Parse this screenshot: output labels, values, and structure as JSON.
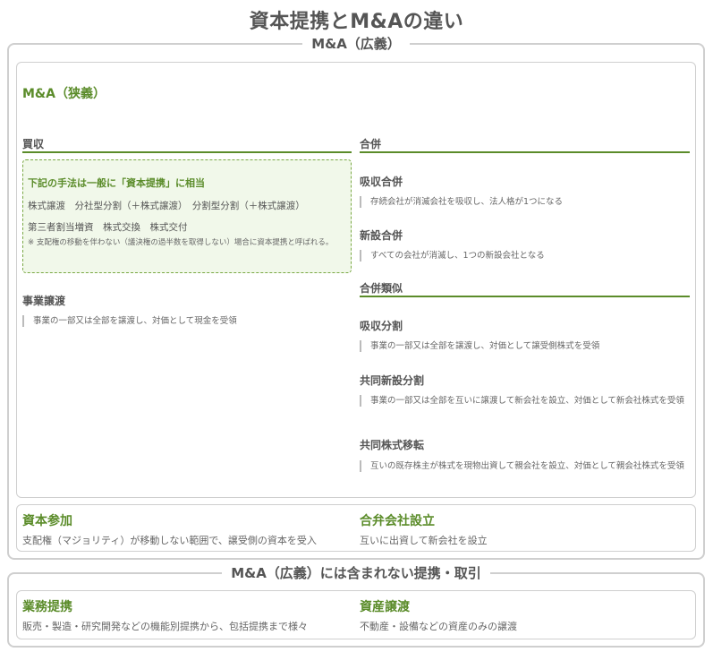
{
  "title": "資本提携とM&Aの違い",
  "ma_broad": {
    "label": "M&A（広義）",
    "ma_narrow": {
      "label": "M&A（狭義）",
      "acquisition": {
        "heading": "買収",
        "box": {
          "heading": "下記の手法は一般に「資本提携」に相当",
          "line1": "株式譲渡　分社型分割（＋株式譲渡）　分割型分割（＋株式譲渡）",
          "line2": "第三者割当増資　株式交換　株式交付",
          "note": "※ 支配権の移動を伴わない（議決権の過半数を取得しない）場合に資本提携と呼ばれる。"
        },
        "business_transfer": {
          "title": "事業譲渡",
          "desc": "事業の一部又は全部を譲渡し、対価として現金を受領"
        }
      },
      "merger": {
        "heading": "合併",
        "absorption": {
          "title": "吸収合併",
          "desc": "存続会社が消滅会社を吸収し、法人格が1つになる"
        },
        "new_merger": {
          "title": "新設合併",
          "desc": "すべての会社が消滅し、1つの新設会社となる"
        }
      },
      "merger_like": {
        "heading": "合併類似",
        "absorption_split": {
          "title": "吸収分割",
          "desc": "事業の一部又は全部を譲渡し、対価として譲受側株式を受領"
        },
        "joint_new_split": {
          "title": "共同新設分割",
          "desc": "事業の一部又は全部を互いに譲渡して新会社を設立、対価として新会社株式を受領"
        },
        "joint_share_transfer": {
          "title": "共同株式移転",
          "desc": "互いの既存株主が株式を現物出資して親会社を設立、対価として親会社株式を受領"
        }
      }
    },
    "capital_participation": {
      "title": "資本参加",
      "desc": "支配権（マジョリティ）が移動しない範囲で、譲受側の資本を受入"
    },
    "joint_venture": {
      "title": "合弁会社設立",
      "desc": "互いに出資して新会社を設立"
    }
  },
  "not_included": {
    "label": "M&A（広義）には含まれない提携・取引",
    "business_alliance": {
      "title": "業務提携",
      "desc": "販売・製造・研究開発などの機能別提携から、包括提携まで様々"
    },
    "asset_transfer": {
      "title": "資産譲渡",
      "desc": "不動産・設備などの資産のみの譲渡"
    }
  },
  "colors": {
    "accent_green": "#5b8c2a",
    "box_fill": "#f1f8ea",
    "border_gray": "#cfcfcf",
    "text_gray": "#555555"
  }
}
